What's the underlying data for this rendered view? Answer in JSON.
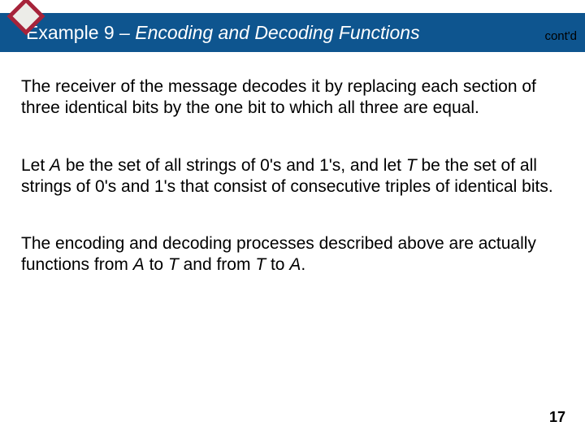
{
  "title": {
    "example_label": "Example 9",
    "dash": " – ",
    "topic": "Encoding and Decoding Functions"
  },
  "contd": "cont'd",
  "paragraphs": {
    "p1": "The receiver of the message decodes it by replacing each section of three identical bits by the one bit to which all three are equal.",
    "p2_a": "Let ",
    "p2_A": "A",
    "p2_b": " be the set of all strings of 0's and 1's, and let ",
    "p2_T": "T",
    "p2_c": " be the set of all strings of 0's and 1's that consist of consecutive triples of identical bits.",
    "p3_a": "The encoding and decoding processes described above are actually functions from ",
    "p3_A1": "A",
    "p3_b": " to ",
    "p3_T1": "T",
    "p3_c": " and from ",
    "p3_T2": "T",
    "p3_d": " to ",
    "p3_A2": "A",
    "p3_e": "."
  },
  "page_number": "17",
  "colors": {
    "title_bar": "#0e558f",
    "diamond_fill": "#ecece8",
    "diamond_stroke": "#a6233a"
  }
}
